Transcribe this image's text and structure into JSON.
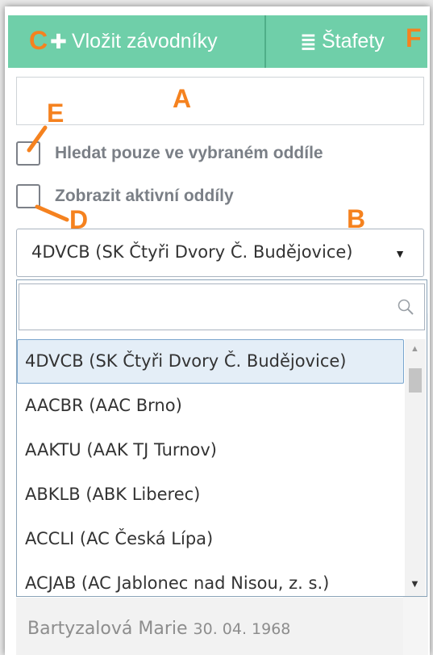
{
  "toolbar": {
    "insert_label": "Vložit závodníky",
    "relay_label": "Štafety",
    "insert_icon": "plus-icon",
    "relay_icon": "list-icon",
    "color": "#6fcfa9"
  },
  "annotations": {
    "a": "A",
    "b": "B",
    "c": "C",
    "d": "D",
    "e": "E",
    "f": "F",
    "color": "#f5821f"
  },
  "filters": {
    "search_in_club_label": "Hledat pouze ve vybraném oddíle",
    "show_active_clubs_label": "Zobrazit aktivní oddíly"
  },
  "club_select": {
    "selected": "4DVCB (SK Čtyři Dvory Č. Budějovice)"
  },
  "club_list": [
    "4DVCB (SK Čtyři Dvory Č. Budějovice)",
    "AACBR (AAC Brno)",
    "AAKTU (AAK TJ Turnov)",
    "ABKLB (ABK Liberec)",
    "ACCLI (AC Česká Lípa)",
    "ACJAB (AC Jablonec nad Nisou, z. s.)"
  ],
  "athlete": {
    "name": "Bartyzalová Marie",
    "birthdate": "30. 04. 1968"
  }
}
